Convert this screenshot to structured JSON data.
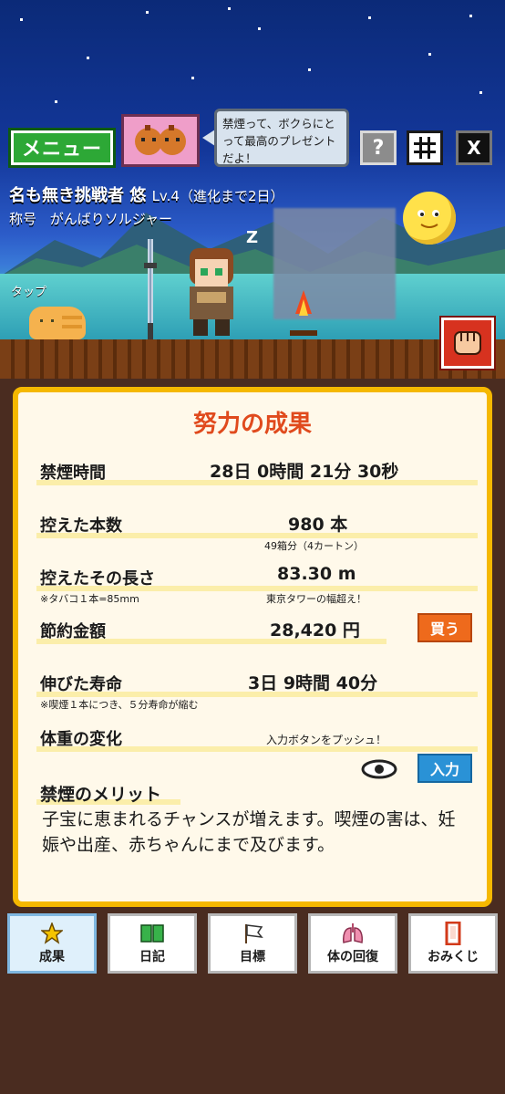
{
  "header": {
    "menu_label": "メニュー",
    "bubble_text": "禁煙って、ボクらにとって最高のプレゼントだよ！",
    "help_label": "?",
    "x_label": "X",
    "icons": [
      "character-icon",
      "grid-icon",
      "x-logo-icon"
    ]
  },
  "player": {
    "name": "名も無き挑戦者 悠",
    "level": "Lv.4（進化まで2日）",
    "title_label": "称号",
    "title_value": "がんばりソルジャー"
  },
  "scene": {
    "tap_label": "タップ",
    "zz": "Z"
  },
  "panel": {
    "title": "努力の成果",
    "rows": {
      "time": {
        "label": "禁煙時間",
        "value": "28日  0時間  21分  30秒"
      },
      "count": {
        "label": "控えた本数",
        "value": "980  本",
        "sub": "49箱分（4カートン）"
      },
      "length": {
        "label": "控えたその長さ",
        "note": "※タバコ１本=85mm",
        "value": "83.30  m",
        "sub": "東京タワーの幅超え！"
      },
      "money": {
        "label": "節約金額",
        "value": "28,420  円",
        "button": "買う"
      },
      "life": {
        "label": "伸びた寿命",
        "note": "※喫煙１本につき、５分寿命が縮む",
        "value": "3日  9時間  40分"
      },
      "weight": {
        "label": "体重の変化",
        "value": "入力ボタンをプッシュ！",
        "button": "入力"
      }
    },
    "merit_title": "禁煙のメリット",
    "merit_text": "子宝に恵まれるチャンスが増えます。喫煙の害は、妊娠や出産、赤ちゃんにまで及びます。"
  },
  "nav": {
    "items": [
      {
        "label": "成果",
        "icon": "star-icon",
        "active": true
      },
      {
        "label": "日記",
        "icon": "book-icon",
        "active": false
      },
      {
        "label": "目標",
        "icon": "flag-icon",
        "active": false
      },
      {
        "label": "体の回復",
        "icon": "lungs-icon",
        "active": false
      },
      {
        "label": "おみくじ",
        "icon": "omikuji-icon",
        "active": false
      }
    ]
  }
}
